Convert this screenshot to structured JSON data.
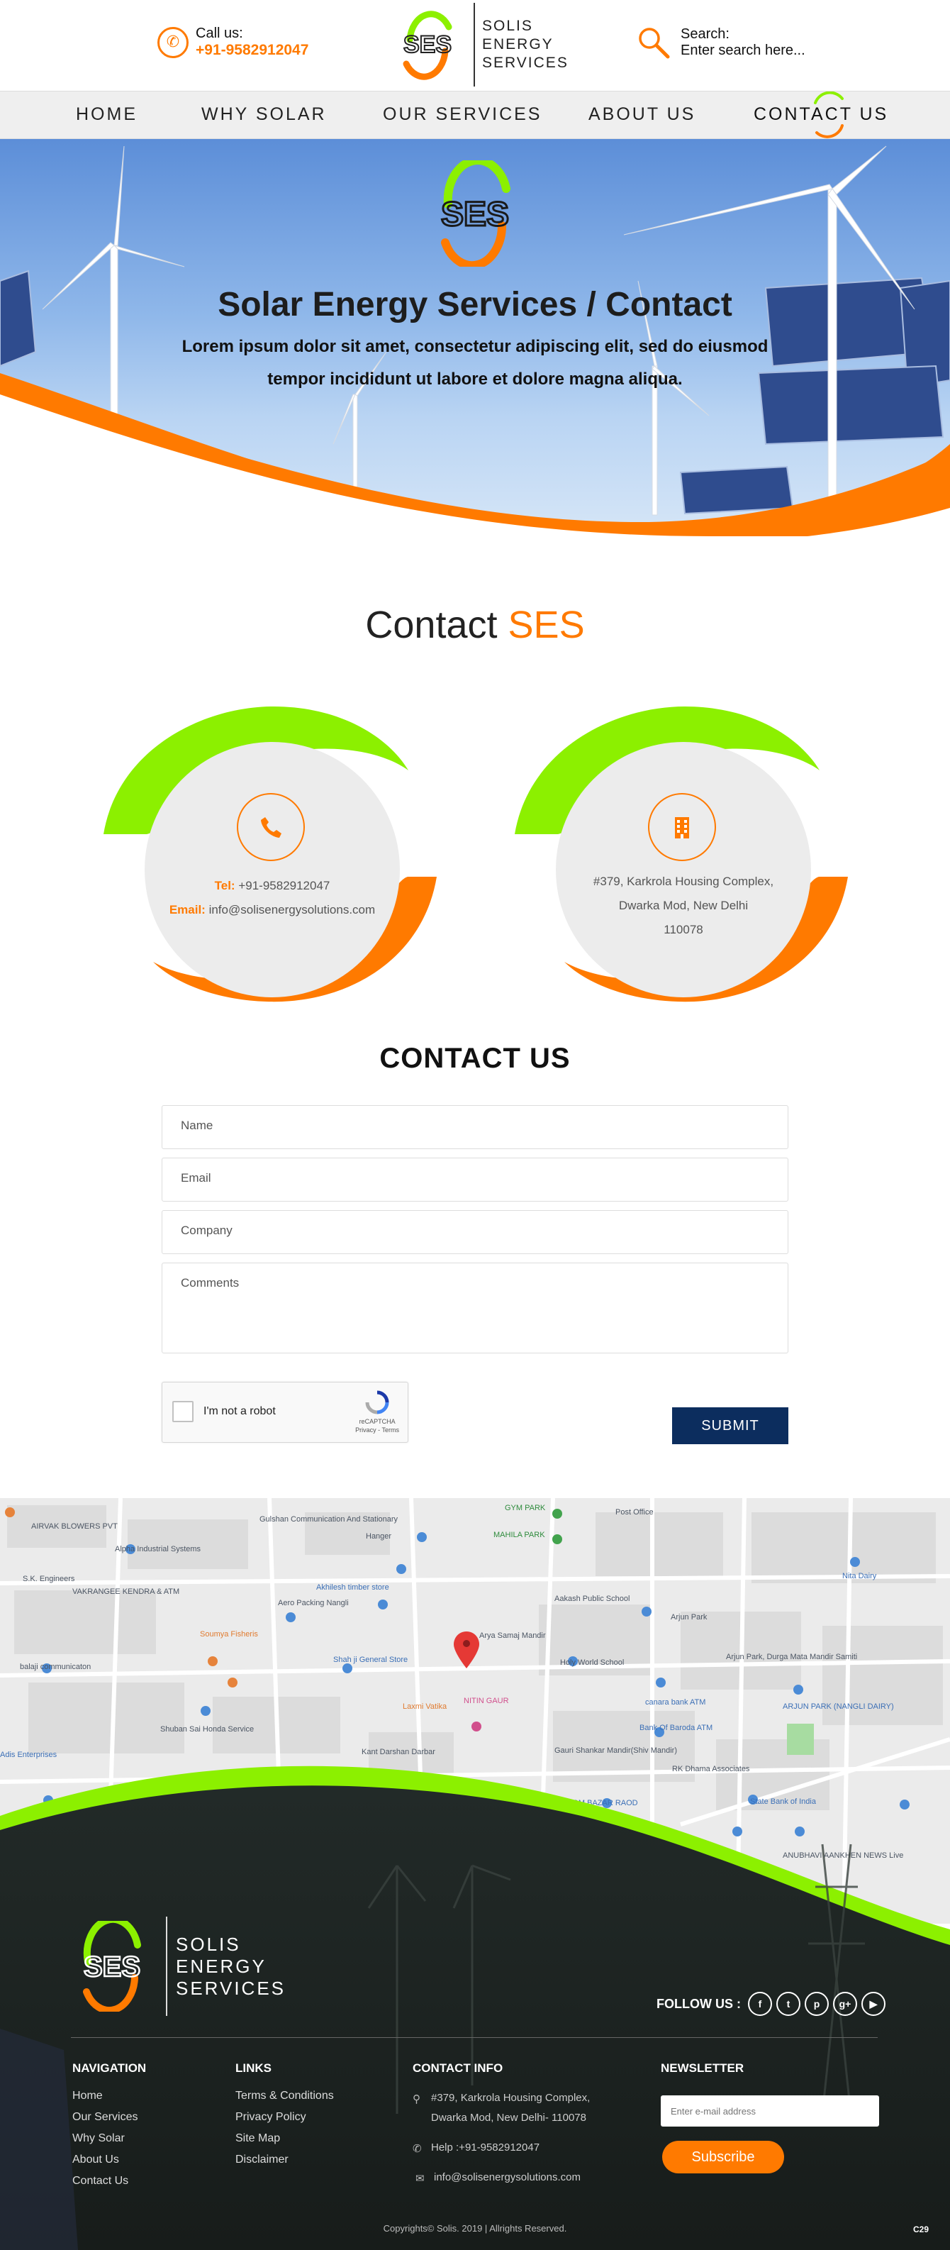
{
  "header": {
    "call_label": "Call us:",
    "call_number": "+91-9582912047",
    "brand_lines": [
      "SOLIS",
      "ENERGY",
      "SERVICES"
    ],
    "search_label": "Search:",
    "search_placeholder": "Enter search here..."
  },
  "nav": {
    "items": [
      "HOME",
      "WHY SOLAR",
      "OUR SERVICES",
      "ABOUT US",
      "CONTACT US"
    ],
    "active": "CONTACT US"
  },
  "hero": {
    "logo_text": "SES",
    "title": "Solar Energy Services / Contact",
    "subtitle": "Lorem ipsum dolor sit amet, consectetur adipiscing elit, sed do eiusmod tempor incididunt ut labore et dolore magna aliqua."
  },
  "contact_section": {
    "title_main": "Contact",
    "title_highlight": "SES",
    "phone_card": {
      "tel_label": "Tel:",
      "tel_value": "+91-9582912047",
      "email_label": "Email:",
      "email_value": "info@solisenergysolutions.com"
    },
    "address_card": {
      "line1": "#379, Karkrola Housing Complex,",
      "line2": "Dwarka Mod, New Delhi",
      "line3": "110078"
    }
  },
  "form": {
    "title": "CONTACT US",
    "name_placeholder": "Name",
    "email_placeholder": "Email",
    "company_placeholder": "Company",
    "comments_placeholder": "Comments",
    "captcha_label": "I'm not a robot",
    "captcha_brand": "reCAPTCHA",
    "captcha_links": "Privacy - Terms",
    "submit_label": "SUBMIT"
  },
  "map": {
    "labels": [
      "Gulshan Communication And Stationary",
      "GYM PARK",
      "MAHILA PARK",
      "Post Office",
      "AIRVAK BLOWERS PVT",
      "Alpha Industrial Systems",
      "Hanger",
      "S.K. Engineers",
      "VAKRANGEE KENDRA & ATM",
      "Akhilesh timber store",
      "Aero Packing Nangli",
      "Aakash Public School",
      "Nita Dairy",
      "Arjun Park",
      "Soumya Fisheris",
      "Arya Samaj Mandir",
      "Holy World School",
      "Arjun Park, Durga Mata Mandir Samiti",
      "balaji communicaton",
      "Shah ji General Store",
      "Laxmi Vatika",
      "NITIN GAUR",
      "canara bank ATM",
      "ARJUN PARK (NANGLI DAIRY)",
      "Shuban Sai Honda Service",
      "Bank Of Baroda ATM",
      "Adis Enterprises",
      "Kant Darshan Darbar",
      "Gauri Shankar Mandir(Shiv Mandir)",
      "RK Dhama Associates",
      "SOM BAZAR RAOD",
      "State Bank of India",
      "ANUBHAVI AANKHEN NEWS Live"
    ]
  },
  "footer": {
    "brand_lines": [
      "SOLIS",
      "ENERGY",
      "SERVICES"
    ],
    "follow_label": "FOLLOW US :",
    "social_icons": [
      "facebook-icon",
      "twitter-icon",
      "pinterest-icon",
      "google-plus-icon",
      "youtube-icon"
    ],
    "navigation_title": "NAVIGATION",
    "navigation": [
      "Home",
      "Our Services",
      "Why Solar",
      "About Us",
      "Contact Us"
    ],
    "links_title": "LINKS",
    "links": [
      "Terms & Conditions",
      "Privacy Policy",
      "Site Map",
      "Disclaimer"
    ],
    "contact_title": "CONTACT INFO",
    "contact_address_1": "#379, Karkrola Housing Complex,",
    "contact_address_2": "Dwarka Mod, New Delhi- 110078",
    "contact_phone": "Help :+91-9582912047",
    "contact_email": "info@solisenergysolutions.com",
    "newsletter_title": "NEWSLETTER",
    "newsletter_placeholder": "Enter e-mail address",
    "subscribe_label": "Subscribe",
    "copyright": "Copyrights© Solis. 2019 | Allrights Reserved.",
    "badge": "C29"
  },
  "colors": {
    "accent_orange": "#ff7a00",
    "accent_green": "#8cf000",
    "navy": "#0c2d5e"
  }
}
